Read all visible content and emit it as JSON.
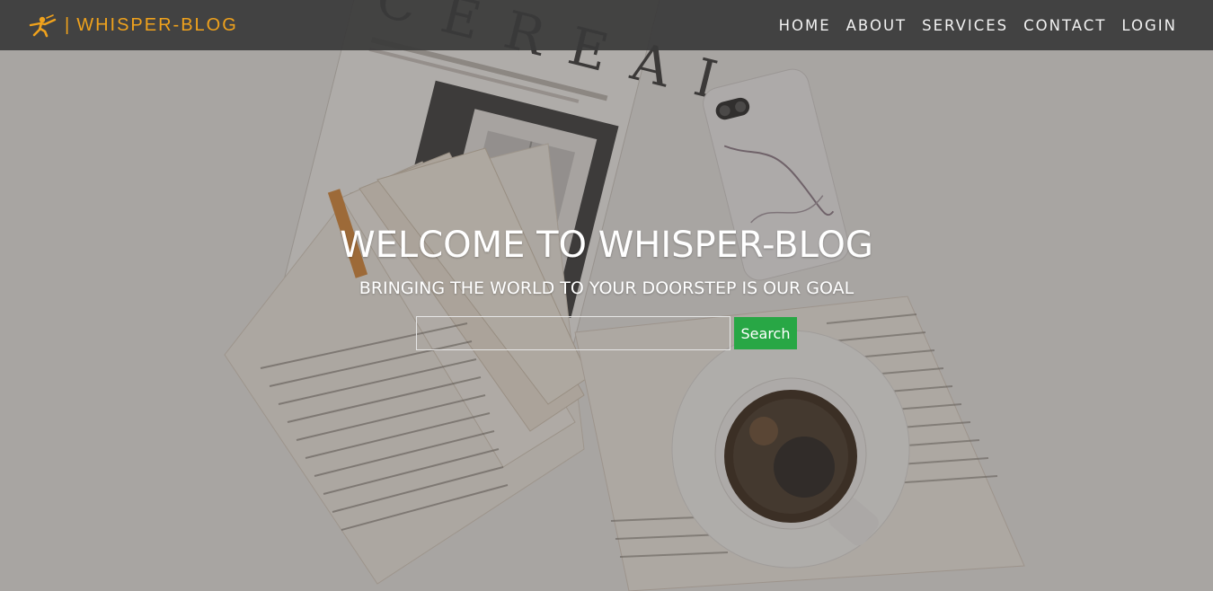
{
  "navbar": {
    "brand_separator": "|",
    "brand_name": "WHISPER-BLOG",
    "brand_color": "#f0a21c",
    "logo_icon": "ninja-figure-icon",
    "links": [
      {
        "label": "HOME"
      },
      {
        "label": "ABOUT"
      },
      {
        "label": "SERVICES"
      },
      {
        "label": "CONTACT"
      },
      {
        "label": "LOGIN"
      }
    ]
  },
  "hero": {
    "title": "WELCOME TO WHISPER-BLOG",
    "subtitle": "BRINGING THE WORLD TO YOUR DOORSTEP IS OUR GOAL",
    "search": {
      "value": "",
      "button_label": "Search",
      "button_color": "#28a745"
    },
    "background_image_label": "CEREAL"
  }
}
